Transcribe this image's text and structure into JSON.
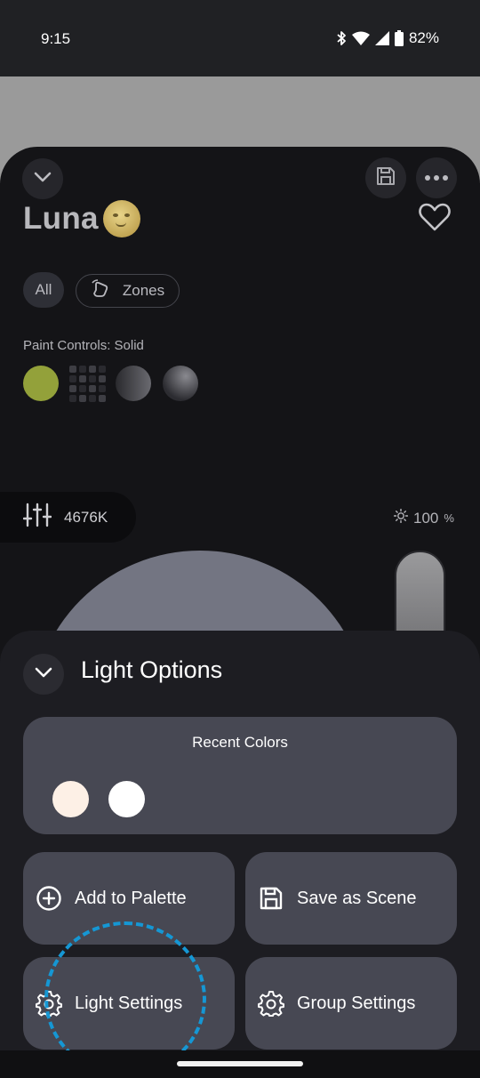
{
  "status_bar": {
    "time": "9:15",
    "battery": "82%"
  },
  "device": {
    "name": "Luna",
    "chips": {
      "all": "All",
      "zones": "Zones"
    },
    "paint_controls_label": "Paint Controls: Solid",
    "paint_colors": {
      "solid": "#93a13a"
    },
    "color_temperature": "4676K",
    "brightness_value": "100",
    "brightness_unit": "%"
  },
  "light_options": {
    "title": "Light Options",
    "recent_colors": {
      "title": "Recent Colors",
      "swatches": [
        "#fdf0e6",
        "#ffffff"
      ]
    },
    "buttons": {
      "add_to_palette": "Add to Palette",
      "save_as_scene": "Save as Scene",
      "light_settings": "Light Settings",
      "group_settings": "Group Settings"
    }
  },
  "icons": {
    "status": [
      "bluetooth-icon",
      "wifi-icon",
      "cellular-signal-icon",
      "battery-icon"
    ],
    "header": [
      "chevron-down-icon",
      "save-icon",
      "more-icon",
      "heart-icon"
    ],
    "misc": [
      "hand-pointer-icon",
      "sliders-icon",
      "sun-icon",
      "plus-circle-icon",
      "gear-icon"
    ]
  }
}
